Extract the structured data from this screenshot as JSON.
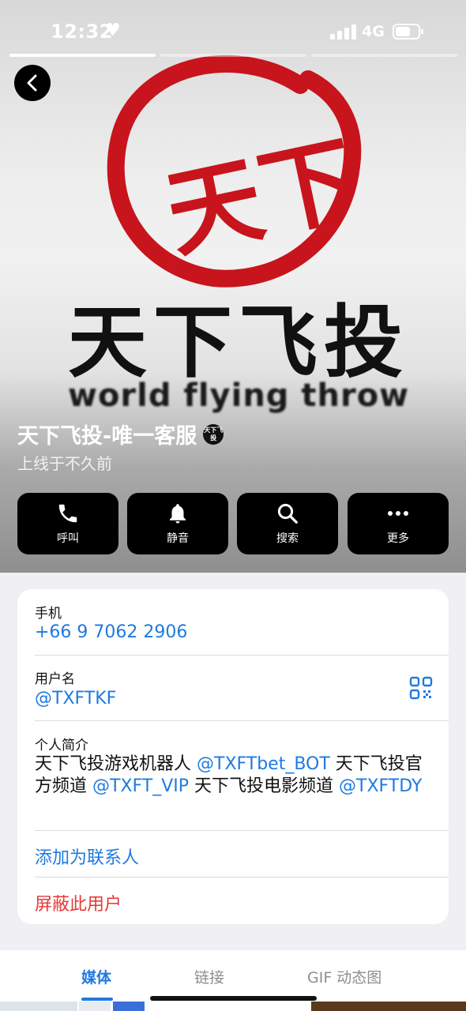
{
  "status_bar": {
    "time": "12:32",
    "network": "4G"
  },
  "profile": {
    "logo_brand": "天下飞投",
    "logo_seal": "天下",
    "logo_subtitle": "world flying throw",
    "name": "天下飞投-唯一客服",
    "avatar_text": "天下飞投",
    "status": "上线于不久前"
  },
  "actions": [
    {
      "label": "呼叫",
      "icon": "phone-icon"
    },
    {
      "label": "静音",
      "icon": "bell-icon"
    },
    {
      "label": "搜索",
      "icon": "search-icon"
    },
    {
      "label": "更多",
      "icon": "more-icon"
    }
  ],
  "info": {
    "phone_label": "手机",
    "phone_value": "+66 9 7062 2906",
    "username_label": "用户名",
    "username_value": "@TXFTKF",
    "bio_label": "个人简介",
    "bio_parts": [
      "天下飞投游戏机器人 ",
      "@TXFTbet_BOT",
      " 天下飞投官方频道 ",
      "@TXFT_VIP",
      " 天下飞投电影频道 ",
      "@TXFTDY"
    ],
    "add_contact": "添加为联系人",
    "block_user": "屏蔽此用户"
  },
  "tabs": [
    {
      "label": "媒体",
      "active": true
    },
    {
      "label": "链接",
      "active": false
    },
    {
      "label": "GIF 动态图",
      "active": false
    }
  ],
  "colors": {
    "accent": "#1f7ae0",
    "danger": "#e53935",
    "logo_red": "#c8141c"
  }
}
